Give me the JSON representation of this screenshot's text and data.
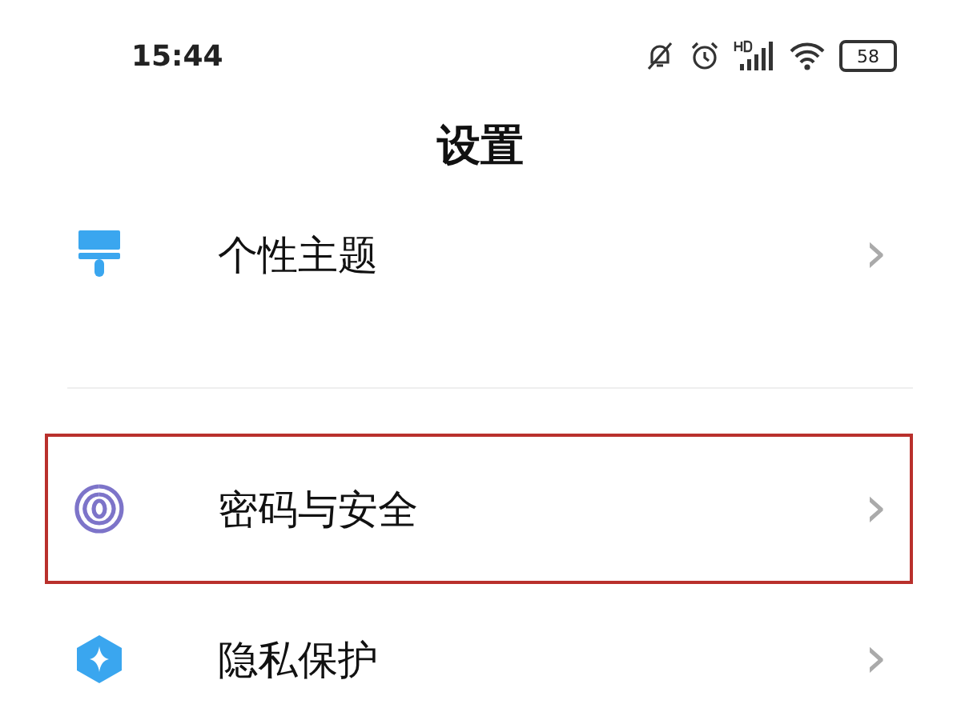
{
  "status_bar": {
    "time": "15:44",
    "battery": "58"
  },
  "title": "设置",
  "groups": [
    {
      "items": [
        {
          "label": "个性主题",
          "kind": "brush",
          "chevron": "›",
          "highlighted": false
        }
      ]
    },
    {
      "items": [
        {
          "label": "密码与安全",
          "kind": "fingerprint",
          "chevron": "›",
          "highlighted": true
        },
        {
          "label": "隐私保护",
          "kind": "shield",
          "chevron": "›",
          "highlighted": false
        }
      ]
    }
  ]
}
